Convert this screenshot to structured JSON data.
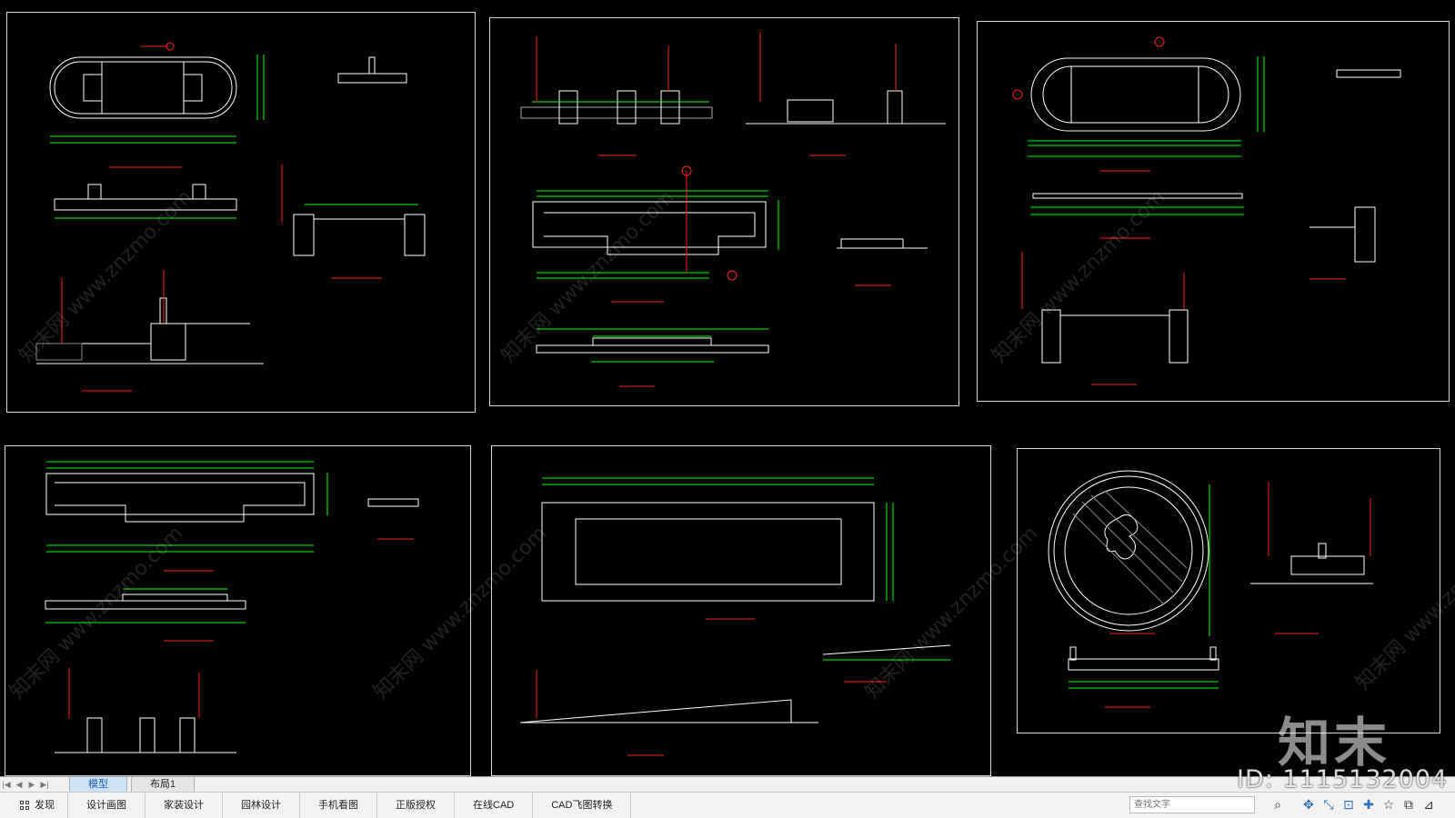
{
  "tabs": {
    "nav": [
      "|◀",
      "◀",
      "▶",
      "▶|"
    ],
    "items": [
      {
        "label": "模型",
        "active": true
      },
      {
        "label": "布局1",
        "active": false
      }
    ]
  },
  "toolbar": {
    "items": [
      "发现",
      "设计画图",
      "家装设计",
      "园林设计",
      "手机看图",
      "正版授权",
      "在线CAD",
      "CAD飞图转换"
    ],
    "search_placeholder": "查找文字"
  },
  "watermark": {
    "logo": "知末",
    "id": "ID: 1115132004",
    "diagonal": "知末网 www.znzmo.com"
  },
  "colors": {
    "canvas": "#000000",
    "sheet_border": "#d8d8d8",
    "geometry": "#ffffff",
    "dimension": "#00ff00",
    "annotation": "#ff2020",
    "tab_active": "#1a5fb4"
  },
  "icons": [
    "grid-icon",
    "search-icon",
    "snap-icon",
    "pan-icon",
    "zoom-icon",
    "crosshair-icon",
    "star-icon",
    "box-icon",
    "orbit-icon"
  ]
}
